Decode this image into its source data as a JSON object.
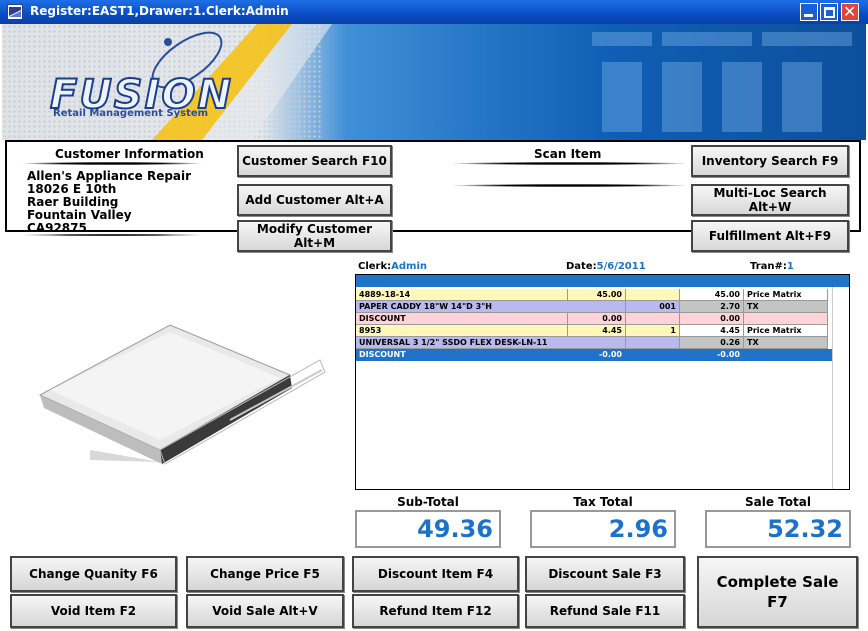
{
  "window": {
    "title": "Register:EAST1,Drawer:1.Clerk:Admin"
  },
  "banner": {
    "logo": "FUSION",
    "tagline": "Retail Management System"
  },
  "customer": {
    "heading": "Customer Information",
    "lines": [
      "Allen's Appliance Repair",
      "18026 E 10th",
      "Raer Building",
      "Fountain Valley",
      "CA92875"
    ]
  },
  "buttons": {
    "customer_search": "Customer Search F10",
    "add_customer": "Add Customer Alt+A",
    "modify_customer": "Modify Customer Alt+M",
    "inventory_search": "Inventory Search F9",
    "multi_loc_search": "Multi-Loc Search Alt+W",
    "fulfillment": "Fulfillment Alt+F9",
    "change_quantity": "Change Quanity F6",
    "change_price": "Change Price F5",
    "discount_item": "Discount Item F4",
    "discount_sale": "Discount Sale F3",
    "void_item": "Void Item F2",
    "void_sale": "Void Sale Alt+V",
    "refund_item": "Refund Item F12",
    "refund_sale": "Refund Sale F11",
    "complete_sale_line1": "Complete Sale",
    "complete_sale_line2": "F7"
  },
  "scan": {
    "heading": "Scan Item"
  },
  "transaction": {
    "clerk_label": "Clerk:",
    "clerk": "Admin",
    "date_label": "Date:",
    "date": "5/6/2011",
    "tran_label": "Tran#:",
    "tran": "1"
  },
  "lines": [
    {
      "sku": "4889-18-14",
      "price": "45.00",
      "qty": "",
      "ext": "45.00",
      "note": "Price Matrix"
    },
    {
      "desc": "PAPER CADDY 18\"W 14\"D 3\"H",
      "code": "001",
      "tax": "2.70",
      "tax_label": "TX"
    },
    {
      "sku": "DISCOUNT",
      "price": "0.00",
      "ext": "0.00"
    },
    {
      "sku": "8953",
      "price": "4.45",
      "qty": "1",
      "ext": "4.45",
      "note": "Price Matrix"
    },
    {
      "desc": "UNIVERSAL 3 1/2\" SSDO FLEX DESK-LN-11",
      "tax": "0.26",
      "tax_label": "TX"
    },
    {
      "sku": "DISCOUNT",
      "price": "-0.00",
      "ext": "-0.00"
    }
  ],
  "totals": {
    "subtotal_label": "Sub-Total",
    "subtotal": "49.36",
    "tax_label": "Tax Total",
    "tax": "2.96",
    "sale_label": "Sale Total",
    "sale": "52.32"
  },
  "colors": {
    "accent_blue": "#1a73c9",
    "row_yellow": "#fff8b8",
    "row_blue": "#b9b9f0",
    "row_pink": "#ffd3d8",
    "title_bar": "#0a4cc4"
  }
}
